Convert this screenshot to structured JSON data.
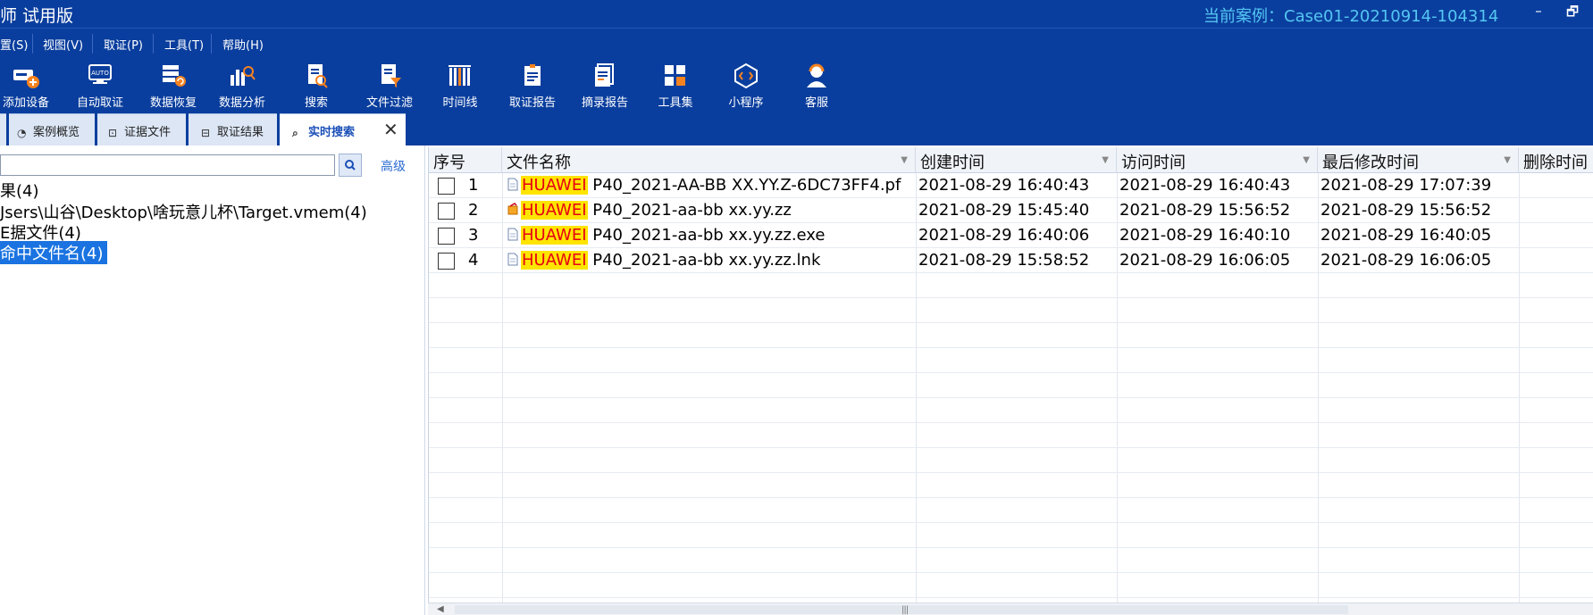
{
  "window": {
    "title": "师 试用版",
    "case_label": "当前案例：Case01-20210914-104314",
    "minimize_icon": "–",
    "restore_icon": "🗗"
  },
  "menu": [
    "置(S)",
    "视图(V)",
    "取证(P)",
    "工具(T)",
    "帮助(H)"
  ],
  "toolbar": [
    {
      "label": "添加设备",
      "icon": "add-device-icon"
    },
    {
      "label": "自动取证",
      "icon": "auto-icon"
    },
    {
      "label": "数据恢复",
      "icon": "data-recovery-icon"
    },
    {
      "label": "数据分析",
      "icon": "data-analysis-icon"
    },
    {
      "label": "搜索",
      "icon": "search-doc-icon"
    },
    {
      "label": "文件过滤",
      "icon": "file-filter-icon"
    },
    {
      "label": "时间线",
      "icon": "timeline-icon"
    },
    {
      "label": "取证报告",
      "icon": "report-icon"
    },
    {
      "label": "摘录报告",
      "icon": "excerpt-report-icon"
    },
    {
      "label": "工具集",
      "icon": "toolset-icon"
    },
    {
      "label": "小程序",
      "icon": "mini-program-icon"
    },
    {
      "label": "客服",
      "icon": "customer-service-icon"
    }
  ],
  "tabs": [
    {
      "label": "案例概览",
      "icon": "pie-icon"
    },
    {
      "label": "证据文件",
      "icon": "evidence-icon"
    },
    {
      "label": "取证结果",
      "icon": "result-icon"
    },
    {
      "label": "实时搜索",
      "icon": "search-icon",
      "active": true
    }
  ],
  "search": {
    "value": "",
    "advanced_label": "高级"
  },
  "tree": [
    "果(4)",
    "Jsers\\山谷\\Desktop\\啥玩意儿杯\\Target.vmem(4)",
    "E据文件(4)",
    "命中文件名(4)"
  ],
  "grid": {
    "columns": [
      "序号",
      "文件名称",
      "创建时间",
      "访问时间",
      "最后修改时间",
      "删除时间"
    ],
    "highlight_term": "HUAWEI",
    "rows": [
      {
        "index": "1",
        "name_rest": " P40_2021-AA-BB XX.YY.Z-6DC73FF4.pf",
        "icon": "doc-icon",
        "created": "2021-08-29 16:40:43",
        "accessed": "2021-08-29 16:40:43",
        "modified": "2021-08-29 17:07:39"
      },
      {
        "index": "2",
        "name_rest": " P40_2021-aa-bb xx.yy.zz",
        "icon": "zip-icon",
        "created": "2021-08-29 15:45:40",
        "accessed": "2021-08-29 15:56:52",
        "modified": "2021-08-29 15:56:52"
      },
      {
        "index": "3",
        "name_rest": " P40_2021-aa-bb xx.yy.zz.exe",
        "icon": "doc-icon",
        "created": "2021-08-29 16:40:06",
        "accessed": "2021-08-29 16:40:10",
        "modified": "2021-08-29 16:40:05"
      },
      {
        "index": "4",
        "name_rest": " P40_2021-aa-bb xx.yy.zz.lnk",
        "icon": "doc-icon",
        "created": "2021-08-29 15:58:52",
        "accessed": "2021-08-29 16:06:05",
        "modified": "2021-08-29 16:06:05"
      }
    ]
  },
  "colors": {
    "titlebar": "#0a3e9e",
    "case_label": "#54c6f2",
    "highlight_bg": "#ffe400",
    "highlight_fg": "#e60012",
    "selection": "#1a73e0"
  }
}
